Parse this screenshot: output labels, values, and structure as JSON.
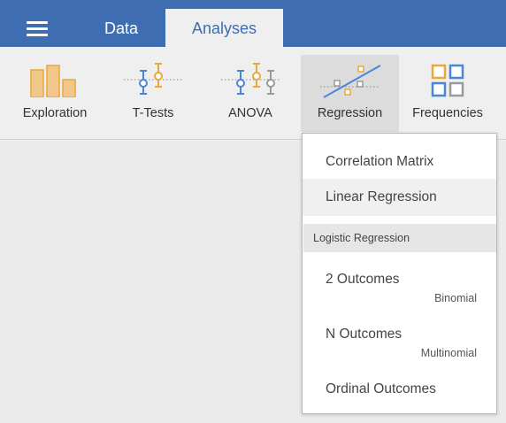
{
  "topbar": {
    "menu_icon": "hamburger-menu-icon",
    "tabs": [
      {
        "label": "Data",
        "active": false
      },
      {
        "label": "Analyses",
        "active": true
      }
    ]
  },
  "ribbon": {
    "buttons": [
      {
        "label": "Exploration",
        "icon": "bar-chart-icon"
      },
      {
        "label": "T-Tests",
        "icon": "t-test-icon"
      },
      {
        "label": "ANOVA",
        "icon": "anova-icon"
      },
      {
        "label": "Regression",
        "icon": "regression-icon",
        "active": true
      },
      {
        "label": "Frequencies",
        "icon": "frequencies-icon"
      }
    ]
  },
  "regression_menu": {
    "items": [
      {
        "label": "Correlation Matrix"
      },
      {
        "label": "Linear Regression",
        "hovered": true
      }
    ],
    "group": {
      "label": "Logistic Regression",
      "items": [
        {
          "label": "2 Outcomes",
          "sub": "Binomial"
        },
        {
          "label": "N Outcomes",
          "sub": "Multinomial"
        },
        {
          "label": "Ordinal Outcomes",
          "sub": ""
        }
      ]
    }
  },
  "colors": {
    "brand_blue": "#3e6db2",
    "icon_orange": "#e8a93a",
    "icon_blue": "#4a86d6",
    "icon_gray": "#9a9a9a"
  }
}
